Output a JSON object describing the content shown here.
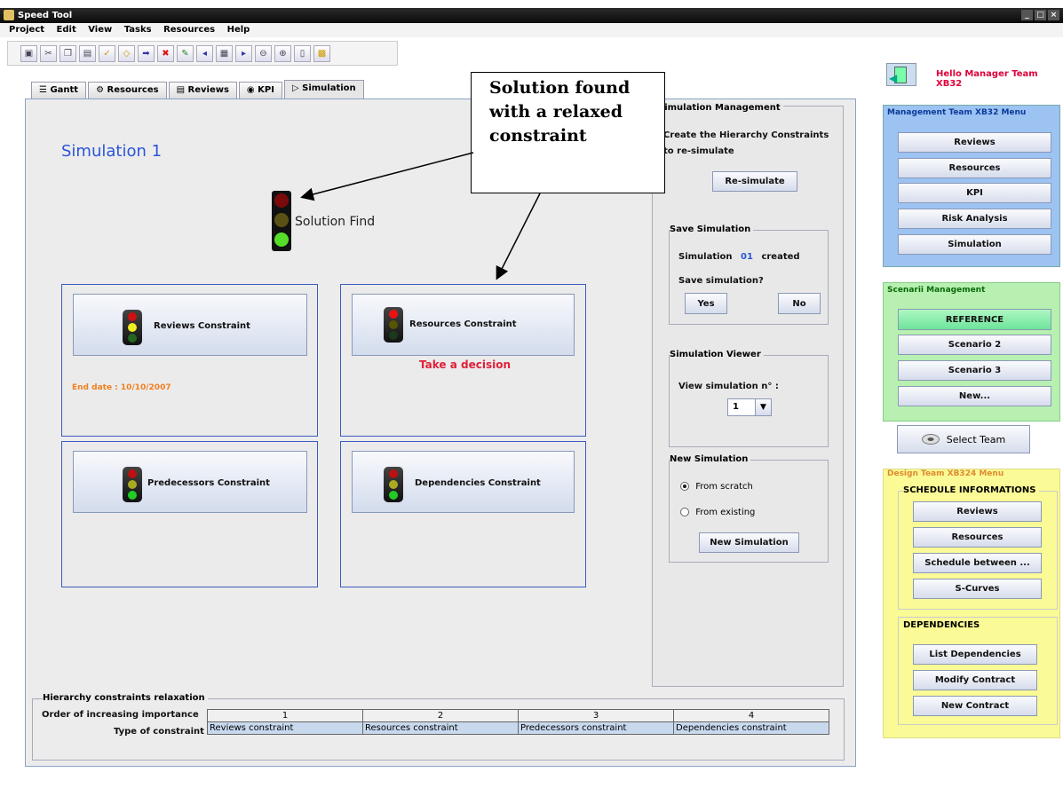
{
  "window": {
    "title": "Speed Tool"
  },
  "menu": [
    "Project",
    "Edit",
    "View",
    "Tasks",
    "Resources",
    "Help"
  ],
  "tabs": [
    "Gantt",
    "Resources",
    "Reviews",
    "KPI",
    "Simulation"
  ],
  "active_tab": "Simulation",
  "simulation": {
    "title": "Simulation 1",
    "status": "Solution Find",
    "constraints": {
      "reviews": {
        "label": "Reviews Constraint",
        "end_date": "End date : 10/10/2007"
      },
      "resources": {
        "label": "Resources Constraint",
        "note": "Take a decision"
      },
      "predecessors": {
        "label": "Predecessors Constraint"
      },
      "dependencies": {
        "label": "Dependencies Constraint"
      }
    }
  },
  "callout": {
    "text": "Solution found with a relaxed constraint"
  },
  "sim_management": {
    "legend": "Simulation Management",
    "text1": "Create the Hierarchy Constraints",
    "text2": "to re-simulate",
    "resimulate": "Re-simulate",
    "save": {
      "legend": "Save Simulation",
      "created_prefix": "Simulation",
      "created_num": "01",
      "created_suffix": "created",
      "question": "Save simulation?",
      "yes": "Yes",
      "no": "No"
    },
    "viewer": {
      "legend": "Simulation Viewer",
      "label": "View simulation n° :",
      "value": "1"
    },
    "new_sim": {
      "legend": "New Simulation",
      "opt1": "From scratch",
      "opt2": "From existing",
      "button": "New Simulation"
    }
  },
  "hierarchy": {
    "legend": "Hierarchy constraints relaxation",
    "row1_label": "Order of increasing importance",
    "row2_label": "Type of constraint",
    "order": [
      "1",
      "2",
      "3",
      "4"
    ],
    "types": [
      "Reviews constraint",
      "Resources constraint",
      "Predecessors constraint",
      "Dependencies constraint"
    ]
  },
  "greeting": "Hello Manager Team XB32",
  "mgmt_menu": {
    "title": "Management Team XB32 Menu",
    "items": [
      "Reviews",
      "Resources",
      "KPI",
      "Risk Analysis",
      "Simulation"
    ]
  },
  "scenarii": {
    "title": "Scenarii Management",
    "items": [
      "REFERENCE",
      "Scenario 2",
      "Scenario 3",
      "New..."
    ]
  },
  "select_team": "Select Team",
  "design_menu": {
    "title": "Design Team XB324 Menu",
    "schedule_title": "SCHEDULE INFORMATIONS",
    "schedule_items": [
      "Reviews",
      "Resources",
      "Schedule between ...",
      "S-Curves"
    ],
    "dep_title": "DEPENDENCIES",
    "dep_items": [
      "List Dependencies",
      "Modify Contract",
      "New Contract"
    ]
  },
  "colors": {
    "accent": "#2a55d8",
    "alert": "#e0203a",
    "end_date": "#f08020",
    "greeting": "#e0003a"
  }
}
